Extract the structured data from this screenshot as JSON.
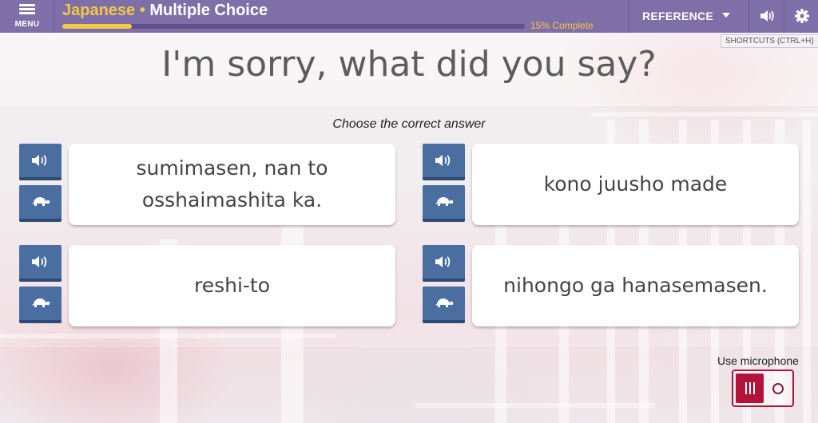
{
  "header": {
    "menu_label": "MENU",
    "language": "Japanese",
    "separator": "•",
    "mode": "Multiple Choice",
    "progress_text": "15% Complete",
    "progress_fraction": 0.15,
    "reference_label": "REFERENCE",
    "shortcuts_tooltip": "SHORTCUTS (CTRL+H)",
    "icons": [
      "menu-icon",
      "chevron-down-icon",
      "speaker-icon",
      "gear-icon"
    ]
  },
  "prompt": "I'm sorry, what did you say?",
  "instruction": "Choose the correct answer",
  "choices": [
    {
      "text": "sumimasen, nan to osshaimashita ka."
    },
    {
      "text": "kono juusho made"
    },
    {
      "text": "reshi-to"
    },
    {
      "text": "nihongo ga hanasemasen."
    }
  ],
  "audio_icons": [
    "speaker-icon",
    "turtle-icon"
  ],
  "microphone": {
    "label": "Use microphone",
    "state": "on"
  },
  "colors": {
    "header": "#7f6fa9",
    "accent_yellow": "#f5c842",
    "audio_button": "#4a6ea0",
    "mic_red": "#b3123a"
  }
}
